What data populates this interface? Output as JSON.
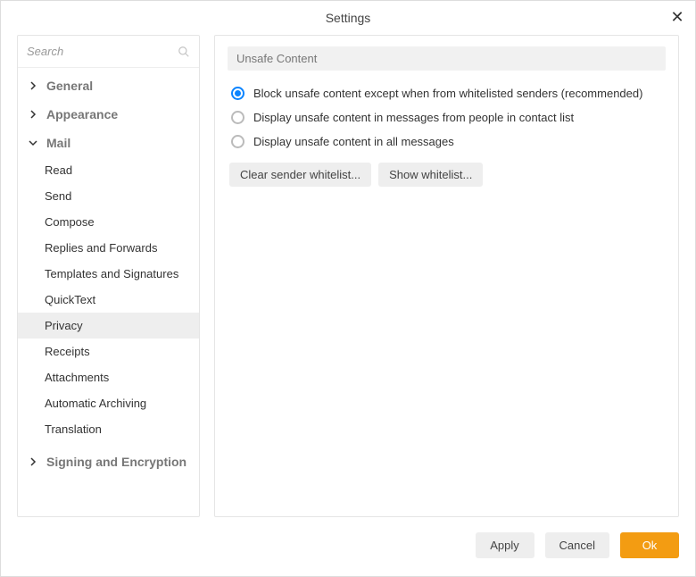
{
  "window": {
    "title": "Settings"
  },
  "search": {
    "placeholder": "Search"
  },
  "sidebar": {
    "sections": [
      {
        "label": "General",
        "expanded": false
      },
      {
        "label": "Appearance",
        "expanded": false
      },
      {
        "label": "Mail",
        "expanded": true
      },
      {
        "label": "Signing and Encryption",
        "expanded": false
      }
    ],
    "mail_items": [
      {
        "label": "Read",
        "active": false
      },
      {
        "label": "Send",
        "active": false
      },
      {
        "label": "Compose",
        "active": false
      },
      {
        "label": "Replies and Forwards",
        "active": false
      },
      {
        "label": "Templates and Signatures",
        "active": false
      },
      {
        "label": "QuickText",
        "active": false
      },
      {
        "label": "Privacy",
        "active": true
      },
      {
        "label": "Receipts",
        "active": false
      },
      {
        "label": "Attachments",
        "active": false
      },
      {
        "label": "Automatic Archiving",
        "active": false
      },
      {
        "label": "Translation",
        "active": false
      }
    ]
  },
  "content": {
    "group_title": "Unsafe Content",
    "options": [
      {
        "label": "Block unsafe content except when from whitelisted senders (recommended)",
        "selected": true
      },
      {
        "label": "Display unsafe content in messages from people in contact list",
        "selected": false
      },
      {
        "label": "Display unsafe content in all messages",
        "selected": false
      }
    ],
    "buttons": {
      "clear_whitelist": "Clear sender whitelist...",
      "show_whitelist": "Show whitelist..."
    }
  },
  "footer": {
    "apply": "Apply",
    "cancel": "Cancel",
    "ok": "Ok"
  }
}
